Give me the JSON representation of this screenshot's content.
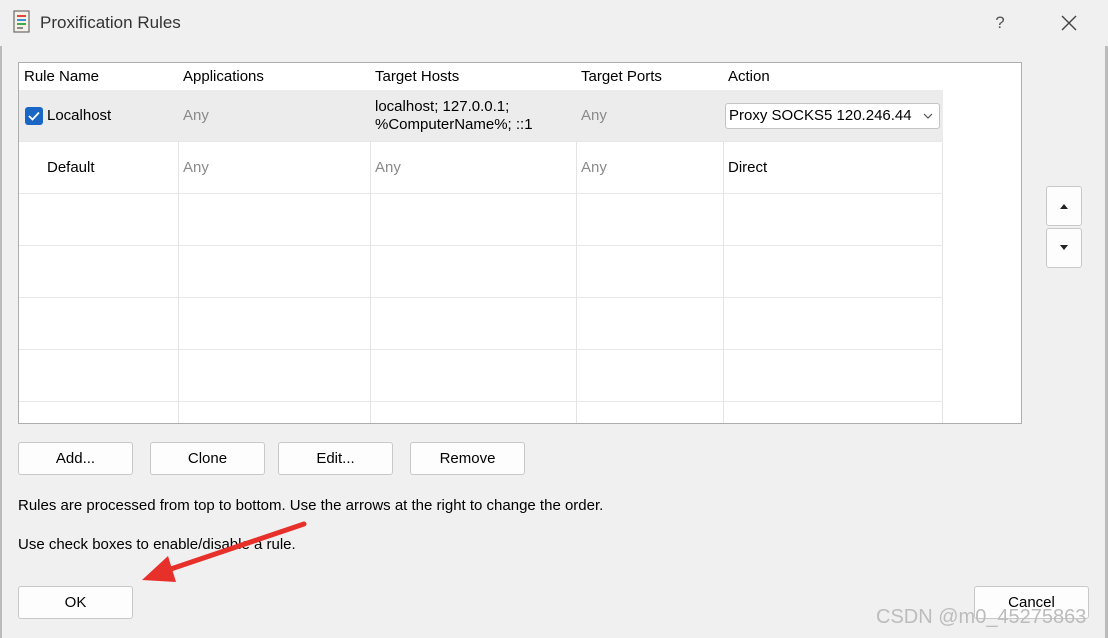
{
  "window": {
    "title": "Proxification Rules",
    "help_label": "?",
    "icon": "rules-document-icon",
    "close_icon": "close-icon"
  },
  "table": {
    "headers": [
      "Rule Name",
      "Applications",
      "Target Hosts",
      "Target Ports",
      "Action"
    ],
    "rows": [
      {
        "checked": true,
        "name": "Localhost",
        "applications": "Any",
        "target_hosts": "localhost; 127.0.0.1;\n%ComputerName%; ::1",
        "target_ports": "Any",
        "action": "Proxy SOCKS5 120.246.44"
      },
      {
        "checked": null,
        "name": "Default",
        "applications": "Any",
        "target_hosts": "Any",
        "target_ports": "Any",
        "action": "Direct"
      }
    ]
  },
  "buttons": {
    "add": "Add...",
    "clone": "Clone",
    "edit": "Edit...",
    "remove": "Remove",
    "ok": "OK",
    "cancel": "Cancel"
  },
  "order_icons": {
    "up": "arrow-up-icon",
    "down": "arrow-down-icon"
  },
  "info": {
    "line1": "Rules are processed from top to bottom. Use the arrows at the right to change the order.",
    "line2": "Use check boxes to enable/disable a rule."
  },
  "watermark": "CSDN @m0_45275863",
  "colors": {
    "checkbox": "#1a66c4",
    "annotation_arrow": "#e8302b",
    "selected_row": "#ececec"
  }
}
